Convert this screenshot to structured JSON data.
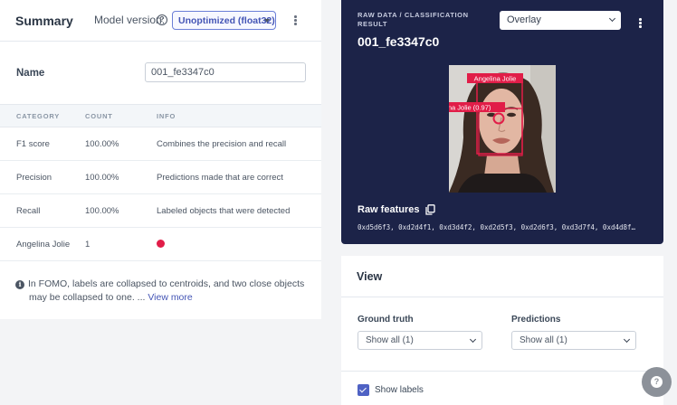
{
  "summary": {
    "title": "Summary",
    "model_version_label": "Model version:",
    "model_version_value": "Unoptimized (float32)"
  },
  "name_field": {
    "label": "Name",
    "value": "001_fe3347c0"
  },
  "table": {
    "headers": [
      "CATEGORY",
      "COUNT",
      "INFO"
    ],
    "rows": [
      {
        "category": "F1 score",
        "count": "100.00%",
        "info": "Combines the precision and recall"
      },
      {
        "category": "Precision",
        "count": "100.00%",
        "info": "Predictions made that are correct"
      },
      {
        "category": "Recall",
        "count": "100.00%",
        "info": "Labeled objects that were detected"
      },
      {
        "category": "Angelina Jolie",
        "count": "1",
        "info_color": "#e11d48"
      }
    ]
  },
  "note": {
    "text_line1": "In FOMO, labels are collapsed to centroids, and two close objects",
    "text_line2": "may be collapsed to one. ... ",
    "link": "View more"
  },
  "raw_panel": {
    "label": "RAW DATA / CLASSIFICATION RESULT",
    "sample_id": "001_fe3347c0",
    "overlay_value": "Overlay",
    "ground_truth_label": "Angelina Jolie",
    "prediction_label": "Angelina Jolie (0.97)",
    "raw_features_title": "Raw features",
    "raw_features_values": "0xd5d6f3, 0xd2d4f1, 0xd3d4f2, 0xd2d5f3, 0xd2d6f3, 0xd3d7f4, 0xd4d8f…"
  },
  "view": {
    "title": "View",
    "ground_truth_label": "Ground truth",
    "ground_truth_value": "Show all (1)",
    "predictions_label": "Predictions",
    "predictions_value": "Show all (1)",
    "show_labels": "Show labels",
    "show_labels_checked": true
  },
  "colors": {
    "accent": "#4f62c4",
    "dark_panel": "#1c2348",
    "label_red": "#e11d48"
  },
  "icons": [
    "help-icon",
    "kebab-menu-icon",
    "info-icon",
    "copy-icon",
    "chevron-down-icon",
    "checkbox-checked-icon",
    "help-fab-icon"
  ]
}
